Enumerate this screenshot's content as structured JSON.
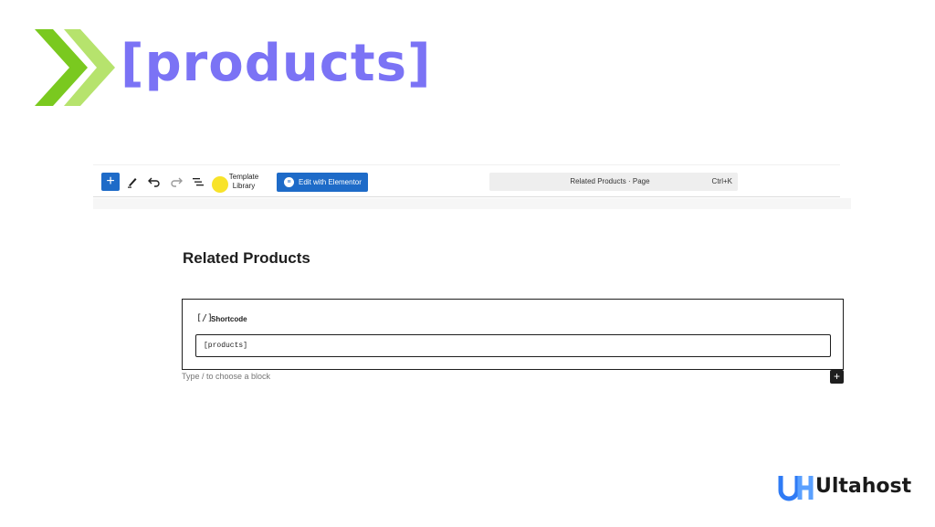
{
  "banner": {
    "logo_icon": "chevrons-right-icon",
    "title": "[products]",
    "colors": {
      "chevron_dark": "#7ac91f",
      "chevron_light": "#b6e36d",
      "title": "#7b73f5"
    }
  },
  "toolbar": {
    "add_icon": "plus-icon",
    "add_label": "+",
    "tools_icon": "pencil-icon",
    "undo_icon": "undo-icon",
    "redo_icon": "redo-icon",
    "outline_icon": "list-view-icon",
    "template_library_line1": "Template",
    "template_library_line2": "Library",
    "elementor_button": "Edit with Elementor",
    "elementor_icon": "elementor-icon",
    "command_title": "Related Products · Page",
    "command_shortcut": "Ctrl+K",
    "accent_color": "#1e6bc8"
  },
  "content": {
    "page_title": "Related Products",
    "shortcode_block": {
      "icon_text": "[/]",
      "label": "Shortcode",
      "value": "[products]"
    },
    "block_hint": "Type / to choose a block",
    "add_block_label": "+"
  },
  "brand": {
    "logo_icon": "uh-logo-icon",
    "name": "Ultahost",
    "color": "#2f7bf5"
  }
}
